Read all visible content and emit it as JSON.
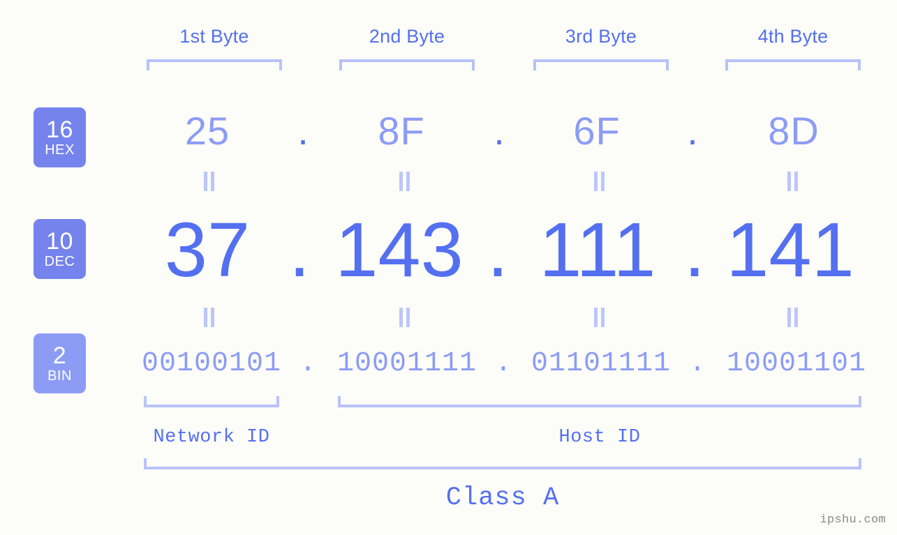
{
  "watermark": "ipshu.com",
  "byte_headers": [
    {
      "label": "1st Byte"
    },
    {
      "label": "2nd Byte"
    },
    {
      "label": "3rd Byte"
    },
    {
      "label": "4th Byte"
    }
  ],
  "bases": [
    {
      "number": "16",
      "name": "HEX",
      "color": "#7583ec"
    },
    {
      "number": "10",
      "name": "DEC",
      "color": "#7583ec"
    },
    {
      "number": "2",
      "name": "BIN",
      "color": "#8c9cf5"
    }
  ],
  "separator": ".",
  "rows": {
    "hex": {
      "base_number": "16",
      "base_name": "HEX",
      "values": [
        "25",
        "8F",
        "6F",
        "8D"
      ]
    },
    "dec": {
      "base_number": "10",
      "base_name": "DEC",
      "values": [
        "37",
        "143",
        "111",
        "141"
      ]
    },
    "bin": {
      "base_number": "2",
      "base_name": "BIN",
      "values": [
        "00100101",
        "10001111",
        "01101111",
        "10001101"
      ]
    }
  },
  "ip": {
    "hex": "25.8F.6F.8D",
    "dec": "37.143.111.141",
    "bin": "00100101.10001111.01101111.10001101"
  },
  "segments": {
    "network_id": "Network ID",
    "host_id": "Host ID",
    "class": "Class A"
  },
  "colors": {
    "background": "#fcfdf8",
    "accent_strong": "#5470f0",
    "accent_light": "#8c9cf5",
    "bracket": "#b8c2fa",
    "badge": "#7583ec",
    "badge_light": "#8c9cf5",
    "watermark": "#8b8b8b"
  }
}
